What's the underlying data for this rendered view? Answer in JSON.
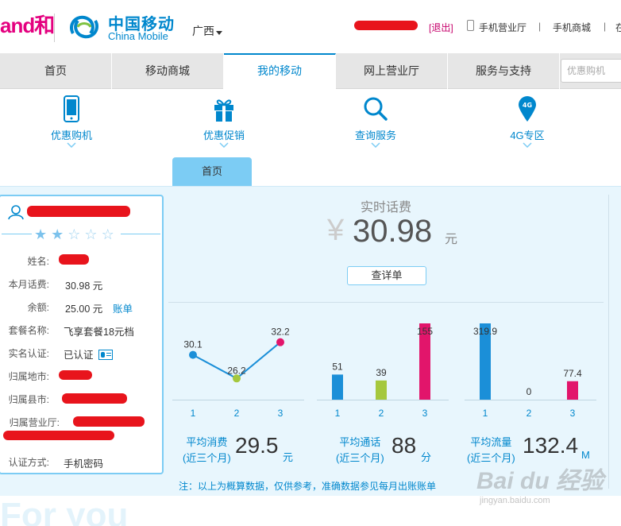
{
  "header": {
    "logo_he": "and和",
    "cm_cn": "中国移动",
    "cm_en": "China Mobile",
    "region": "广西",
    "logout": "[退出]",
    "links": [
      "手机营业厅",
      "手机商城",
      "在"
    ],
    "sep": "|"
  },
  "nav": {
    "items": [
      "首页",
      "移动商城",
      "我的移动",
      "网上营业厅",
      "服务与支持"
    ],
    "active": "我的移动",
    "search_placeholder": "优惠购机"
  },
  "subnav": {
    "items": [
      "优惠购机",
      "优惠促销",
      "查询服务",
      "4G专区"
    ],
    "badge_4g": "4G",
    "home_tab": "首页"
  },
  "user_card": {
    "stars_on": 2,
    "stars_total": 5,
    "rows": [
      {
        "label": "姓名:",
        "value": ""
      },
      {
        "label": "本月话费:",
        "value": "30.98 元"
      },
      {
        "label": "余额:",
        "value": "25.00 元",
        "link": "账单"
      },
      {
        "label": "套餐名称:",
        "value": "飞享套餐18元档"
      },
      {
        "label": "实名认证:",
        "value": "已认证"
      },
      {
        "label": "归属地市:",
        "value": ""
      },
      {
        "label": "归属县市:",
        "value": ""
      },
      {
        "label": "归属营业厅:",
        "value": ""
      },
      {
        "label": "认证方式:",
        "value": "手机密码"
      }
    ]
  },
  "fee": {
    "title": "实时话费",
    "yen": "¥",
    "amount": "30.98",
    "unit": "元",
    "detail_button": "查详单"
  },
  "chart_data": [
    {
      "type": "line",
      "x": [
        "1",
        "2",
        "3"
      ],
      "values": [
        30.1,
        26.2,
        32.2
      ],
      "labels": [
        "30.1",
        "26.2",
        "32.2"
      ],
      "colors": [
        "#1b8fd8",
        "#a5c83d",
        "#e2156b"
      ]
    },
    {
      "type": "bar",
      "categories": [
        "1",
        "2",
        "3"
      ],
      "values": [
        51,
        39,
        155
      ],
      "labels": [
        "51",
        "39",
        "155"
      ],
      "colors": [
        "#1b8fd8",
        "#a5c83d",
        "#e2156b"
      ],
      "ylim": [
        0,
        155
      ]
    },
    {
      "type": "bar",
      "categories": [
        "1",
        "2",
        "3"
      ],
      "values": [
        319.9,
        0,
        77.4
      ],
      "labels": [
        "319.9",
        "0",
        "77.4"
      ],
      "colors": [
        "#1b8fd8",
        "#a5c83d",
        "#e2156b"
      ],
      "ylim": [
        0,
        319.9
      ]
    }
  ],
  "averages": [
    {
      "label1": "平均消费",
      "label2": "(近三个月)",
      "value": "29.5",
      "unit": "元"
    },
    {
      "label1": "平均通话",
      "label2": "(近三个月)",
      "value": "88",
      "unit": "分"
    },
    {
      "label1": "平均流量",
      "label2": "(近三个月)",
      "value": "132.4",
      "unit": "M"
    }
  ],
  "note": "注：以上为概算数据，仅供参考，准确数据参见每月出账账单",
  "bottom": {
    "for_you": "For you"
  },
  "watermark": {
    "text": "Bai du 经验",
    "url": "jingyan.baidu.com"
  }
}
